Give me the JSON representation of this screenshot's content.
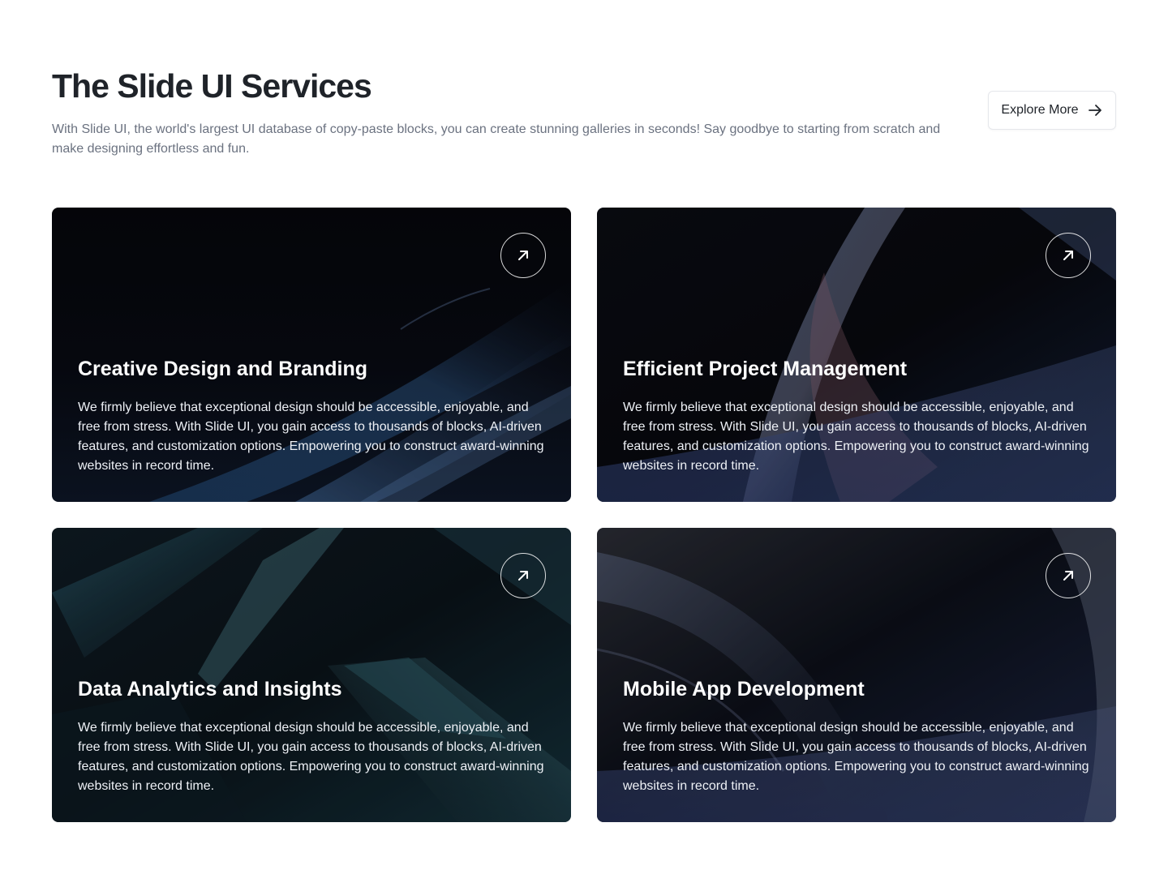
{
  "header": {
    "title": "The Slide UI Services",
    "subtitle": "With Slide UI, the world's largest UI database of copy-paste blocks, you can create stunning galleries in seconds! Say goodbye to starting from scratch and make designing effortless and fun.",
    "explore_label": "Explore More"
  },
  "cards": [
    {
      "title": "Creative Design and Branding",
      "description": "We firmly believe that exceptional design should be accessible, enjoyable, and free from stress. With Slide UI, you gain access to thousands of blocks, AI-driven features, and customization options. Empowering you to construct award-winning websites in record time."
    },
    {
      "title": "Efficient Project Management",
      "description": "We firmly believe that exceptional design should be accessible, enjoyable, and free from stress. With Slide UI, you gain access to thousands of blocks, AI-driven features, and customization options. Empowering you to construct award-winning websites in record time."
    },
    {
      "title": "Data Analytics and Insights",
      "description": "We firmly believe that exceptional design should be accessible, enjoyable, and free from stress. With Slide UI, you gain access to thousands of blocks, AI-driven features, and customization options. Empowering you to construct award-winning websites in record time."
    },
    {
      "title": "Mobile App Development",
      "description": "We firmly believe that exceptional design should be accessible, enjoyable, and free from stress. With Slide UI, you gain access to thousands of blocks, AI-driven features, and customization options. Empowering you to construct award-winning websites in record time."
    }
  ],
  "icons": {
    "explore": "arrow-right-icon",
    "card": "arrow-up-right-icon"
  },
  "colors": {
    "title": "#1f2329",
    "subtitle": "#6b7280",
    "card_dark": "#07080c"
  }
}
